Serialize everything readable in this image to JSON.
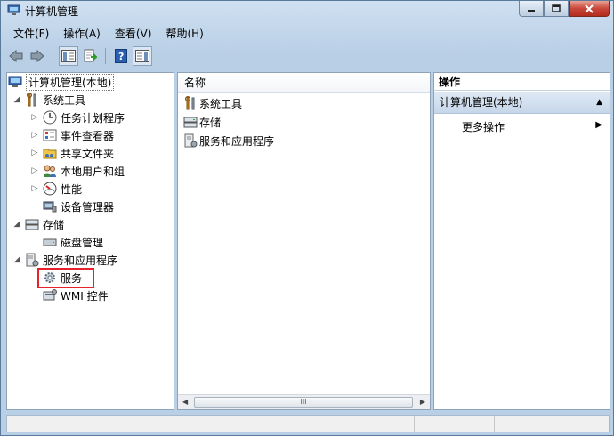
{
  "window": {
    "title": "计算机管理"
  },
  "menu": [
    {
      "label": "文件(F)"
    },
    {
      "label": "操作(A)"
    },
    {
      "label": "查看(V)"
    },
    {
      "label": "帮助(H)"
    }
  ],
  "toolbar": {
    "icons": [
      "back-icon",
      "forward-icon",
      "show-hide-tree-icon",
      "export-list-icon",
      "help-icon",
      "show-hide-action-pane-icon"
    ]
  },
  "tree": {
    "root": "计算机管理(本地)",
    "system_tools": "系统工具",
    "task_scheduler": "任务计划程序",
    "event_viewer": "事件查看器",
    "shared_folders": "共享文件夹",
    "local_users": "本地用户和组",
    "performance": "性能",
    "device_manager": "设备管理器",
    "storage": "存储",
    "disk_management": "磁盘管理",
    "services_apps": "服务和应用程序",
    "services": "服务",
    "wmi": "WMI 控件"
  },
  "list": {
    "column_name": "名称",
    "items": [
      "系统工具",
      "存储",
      "服务和应用程序"
    ],
    "scroll_grip": "III"
  },
  "actions": {
    "header": "操作",
    "section": "计算机管理(本地)",
    "more": "更多操作"
  },
  "colors": {
    "highlight": "#e8212d",
    "accent": "#c6d7ea"
  }
}
